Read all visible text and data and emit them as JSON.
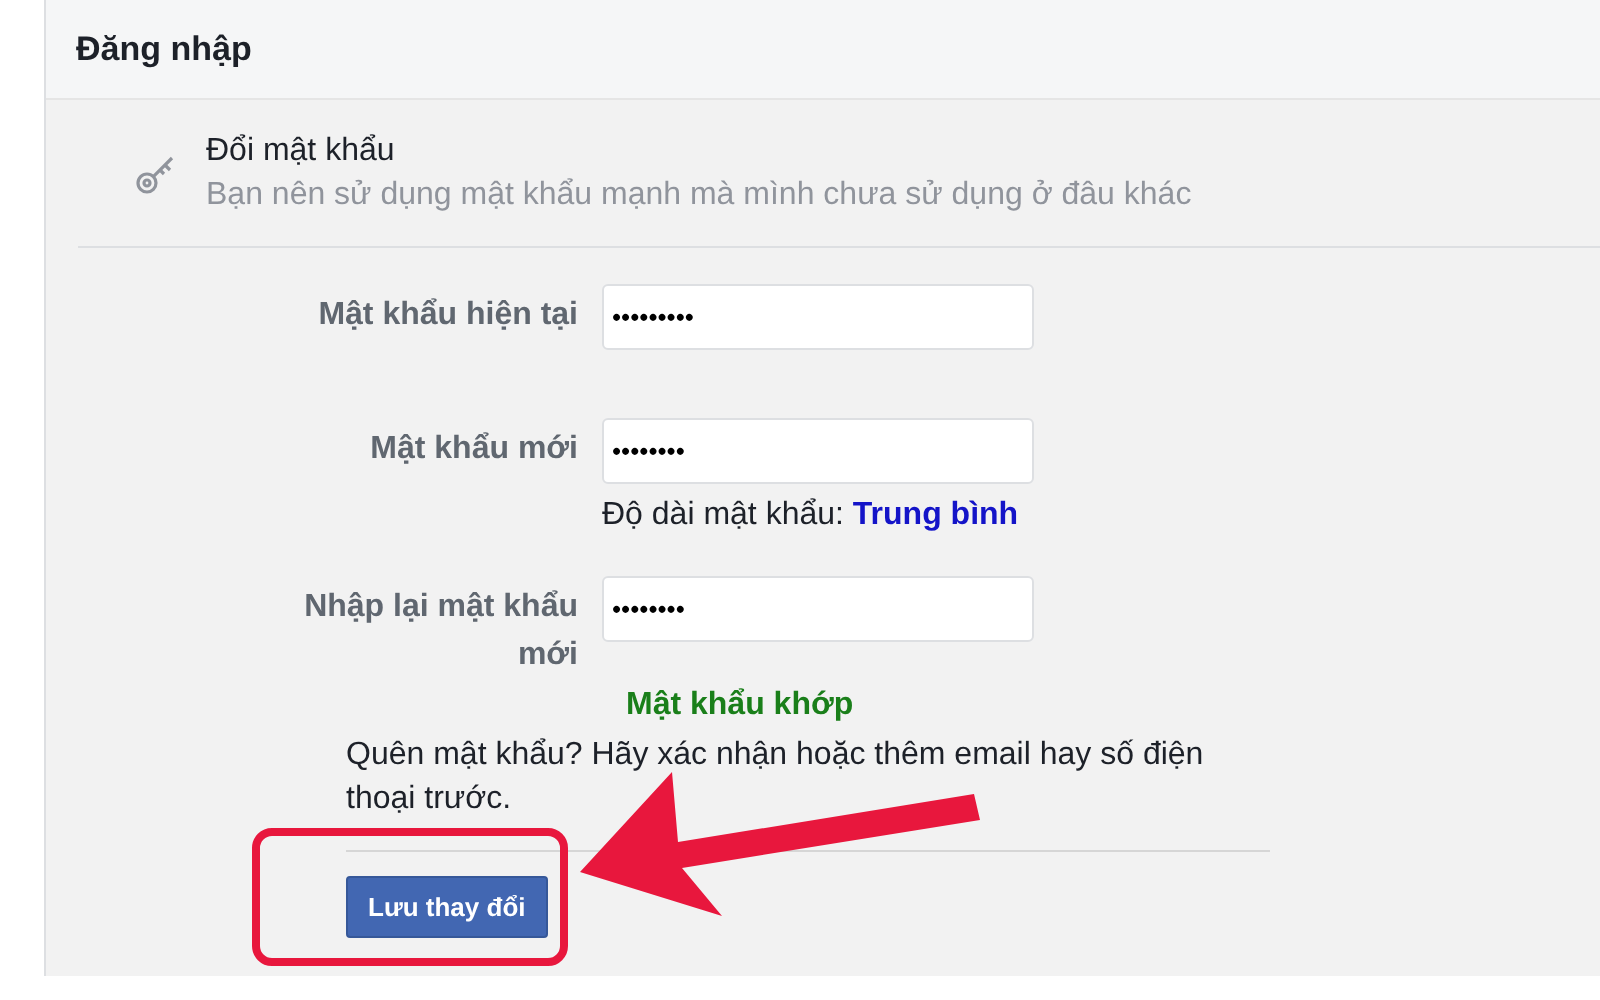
{
  "section": {
    "title": "Đăng nhập"
  },
  "setting": {
    "title": "Đổi mật khẩu",
    "description": "Bạn nên sử dụng mật khẩu mạnh mà mình chưa sử dụng ở đâu khác"
  },
  "fields": [
    {
      "label": "Mật khẩu hiện tại",
      "value": "•••••••••"
    },
    {
      "label": "Mật khẩu mới",
      "value": "••••••••",
      "hint": "Độ dài mật khẩu: **Trung bình**"
    },
    {
      "label": "Nhập lại mật khẩu mới",
      "value": "••••••••",
      "status": "Mật khẩu khớp"
    }
  ],
  "forgot_note": "Quên mật khẩu? Hãy xác nhận hoặc thêm email hay số điện thoại trước.",
  "save_button": "Lưu thay đổi"
}
